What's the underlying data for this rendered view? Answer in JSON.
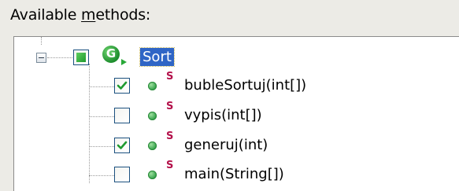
{
  "header": {
    "label_prefix": "Available ",
    "label_accel": "m",
    "label_suffix": "ethods:"
  },
  "tree": {
    "root": {
      "label": "Sort",
      "class_icon_letter": "G",
      "selected": true,
      "expanded": true
    },
    "methods": [
      {
        "label": "bubleSortuj(int[])",
        "checked": true,
        "static_marker": "S"
      },
      {
        "label": "vypis(int[])",
        "checked": false,
        "static_marker": "S"
      },
      {
        "label": "generuj(int)",
        "checked": true,
        "static_marker": "S"
      },
      {
        "label": "main(String[])",
        "checked": false,
        "static_marker": "S"
      }
    ]
  },
  "colors": {
    "selection": "#2f65c6",
    "check": "#1f9a2f",
    "static": "#b4124b"
  }
}
